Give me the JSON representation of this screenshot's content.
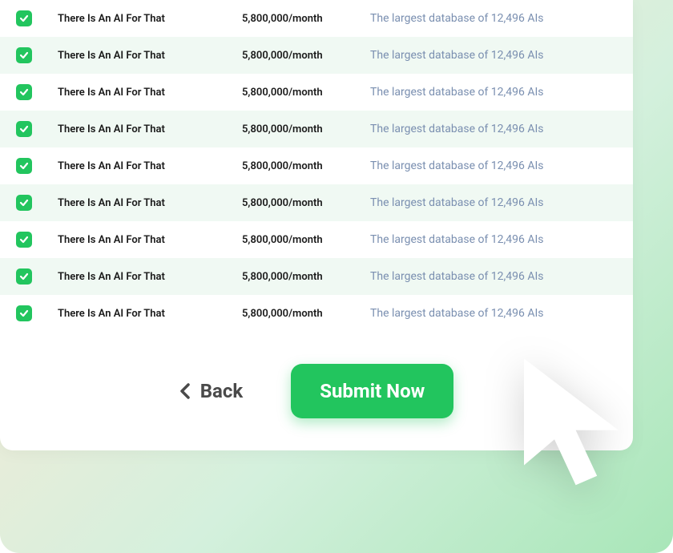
{
  "colors": {
    "accent": "#22c55e",
    "muted_text": "#7a8fb0"
  },
  "rows": [
    {
      "checked": true,
      "name": "There Is An AI For That",
      "traffic": "5,800,000/month",
      "description": "The largest database of 12,496 AIs"
    },
    {
      "checked": true,
      "name": "There Is An AI For That",
      "traffic": "5,800,000/month",
      "description": "The largest database of 12,496 AIs"
    },
    {
      "checked": true,
      "name": "There Is An AI For That",
      "traffic": "5,800,000/month",
      "description": "The largest database of 12,496 AIs"
    },
    {
      "checked": true,
      "name": "There Is An AI For That",
      "traffic": "5,800,000/month",
      "description": "The largest database of 12,496 AIs"
    },
    {
      "checked": true,
      "name": "There Is An AI For That",
      "traffic": "5,800,000/month",
      "description": "The largest database of 12,496 AIs"
    },
    {
      "checked": true,
      "name": "There Is An AI For That",
      "traffic": "5,800,000/month",
      "description": "The largest database of 12,496 AIs"
    },
    {
      "checked": true,
      "name": "There Is An AI For That",
      "traffic": "5,800,000/month",
      "description": "The largest database of 12,496 AIs"
    },
    {
      "checked": true,
      "name": "There Is An AI For That",
      "traffic": "5,800,000/month",
      "description": "The largest database of 12,496 AIs"
    },
    {
      "checked": true,
      "name": "There Is An AI For That",
      "traffic": "5,800,000/month",
      "description": "The largest database of 12,496 AIs"
    }
  ],
  "buttons": {
    "back_label": "Back",
    "submit_label": "Submit Now"
  }
}
